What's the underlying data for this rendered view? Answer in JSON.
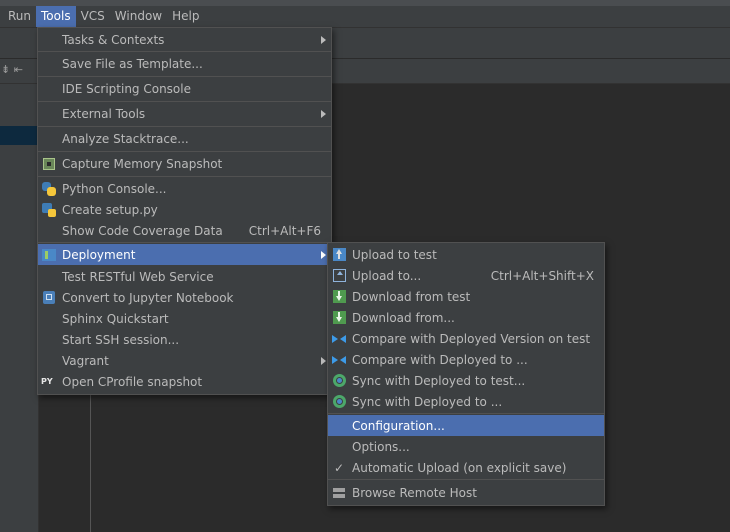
{
  "menubar": {
    "items": [
      {
        "label": "Run"
      },
      {
        "label": "Tools"
      },
      {
        "label": "VCS"
      },
      {
        "label": "Window"
      },
      {
        "label": "Help"
      }
    ]
  },
  "tools_menu": {
    "tasks_contexts": "Tasks & Contexts",
    "save_file_as_template": "Save File as Template...",
    "ide_scripting_console": "IDE Scripting Console",
    "external_tools": "External Tools",
    "analyze_stacktrace": "Analyze Stacktrace...",
    "capture_memory_snapshot": "Capture Memory Snapshot",
    "python_console": "Python Console...",
    "create_setup_py": "Create setup.py",
    "show_code_coverage": "Show Code Coverage Data",
    "show_code_coverage_shortcut": "Ctrl+Alt+F6",
    "deployment": "Deployment",
    "test_restful": "Test RESTful Web Service",
    "convert_jupyter": "Convert to Jupyter Notebook",
    "sphinx_quickstart": "Sphinx Quickstart",
    "start_ssh": "Start SSH session...",
    "vagrant": "Vagrant",
    "open_cprofile": "Open CProfile snapshot",
    "cprofile_icon_text": "PY"
  },
  "deployment_menu": {
    "upload_to_test": "Upload to test",
    "upload_to": "Upload to...",
    "upload_to_shortcut": "Ctrl+Alt+Shift+X",
    "download_from_test": "Download from test",
    "download_from": "Download from...",
    "compare_deployed_test": "Compare with Deployed Version on test",
    "compare_deployed_to": "Compare with Deployed to ...",
    "sync_deployed_test": "Sync with Deployed to test...",
    "sync_deployed_to": "Sync with Deployed to ...",
    "configuration": "Configuration...",
    "options": "Options...",
    "automatic_upload": "Automatic Upload (on explicit save)",
    "browse_remote_host": "Browse Remote Host"
  },
  "toolbar": {
    "left_icons": "⇟ ⇤"
  },
  "colors": {
    "background": "#2b2b2b",
    "panel": "#3c3f41",
    "selection": "#4b6eaf",
    "text": "#bbbbbb"
  }
}
